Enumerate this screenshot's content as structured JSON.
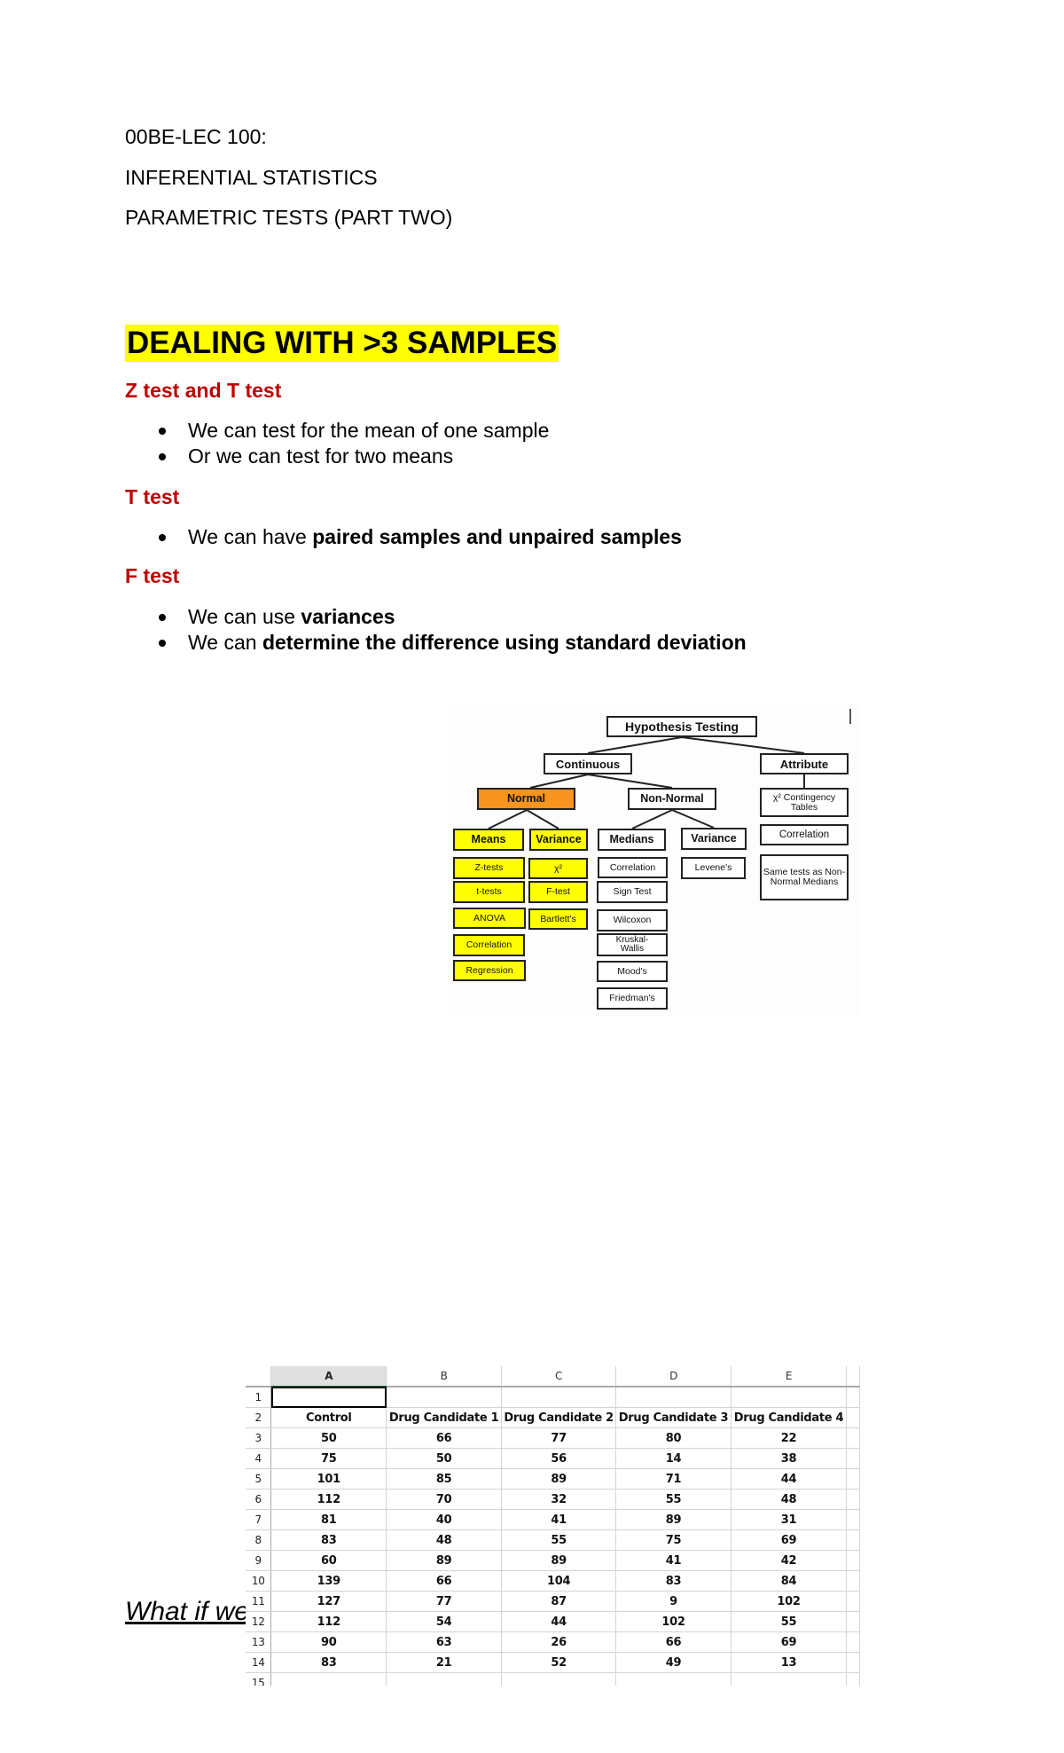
{
  "title_lines": [
    "00BE-LEC 100:",
    "INFERENTIAL STATISTICS",
    "PARAMETRIC TESTS (PART TWO)"
  ],
  "heading": "DEALING WITH >3 SAMPLES",
  "sections": [
    {
      "title": "Z test and T test",
      "bullets": [
        {
          "plain": "We can test for the mean of one sample",
          "bold": ""
        },
        {
          "plain": "Or we can test for two means",
          "bold": ""
        }
      ]
    },
    {
      "title": "T test",
      "bullets": [
        {
          "plain": "We can have ",
          "bold": "paired samples and unpaired samples"
        }
      ]
    },
    {
      "title": "F test",
      "bullets": [
        {
          "plain": "We can use ",
          "bold": "variances"
        },
        {
          "plain": "We can ",
          "bold": "determine the difference using standard deviation"
        }
      ]
    }
  ],
  "diagram": {
    "root": "Hypothesis Testing",
    "continuous": "Continuous",
    "attribute": "Attribute",
    "normal": "Normal",
    "non_normal": "Non-Normal",
    "means": "Means",
    "variance_normal": "Variance",
    "medians": "Medians",
    "variance_nonnormal": "Variance",
    "means_tests": [
      "Z-tests",
      "t-tests",
      "ANOVA",
      "Correlation",
      "Regression"
    ],
    "variance_tests": [
      "χ²",
      "F-test",
      "Bartlett's"
    ],
    "median_tests": [
      "Correlation",
      "Sign Test",
      "Wilcoxon",
      "Kruskal-Wallis",
      "Mood's",
      "Friedman's"
    ],
    "nn_variance_tests": [
      "Levene's"
    ],
    "attribute_tests": [
      "χ² Contingency Tables",
      "Correlation",
      "Same tests as Non-Normal Medians"
    ],
    "colors": {
      "normal": "#f7941d",
      "normal_children": "#ffff00"
    }
  },
  "spreadsheet": {
    "column_letters": [
      "A",
      "B",
      "C",
      "D",
      "E"
    ],
    "selected_cell": "A1",
    "headers": [
      "Control",
      "Drug Candidate 1",
      "Drug Candidate 2",
      "Drug Candidate 3",
      "Drug Candidate 4"
    ],
    "rows": [
      [
        50,
        66,
        77,
        80,
        22
      ],
      [
        75,
        50,
        56,
        14,
        38
      ],
      [
        101,
        85,
        89,
        71,
        44
      ],
      [
        112,
        70,
        32,
        55,
        48
      ],
      [
        81,
        40,
        41,
        89,
        31
      ],
      [
        83,
        48,
        55,
        75,
        69
      ],
      [
        60,
        89,
        89,
        41,
        42
      ],
      [
        139,
        66,
        104,
        83,
        84
      ],
      [
        127,
        77,
        87,
        9,
        102
      ],
      [
        112,
        54,
        44,
        102,
        55
      ],
      [
        90,
        63,
        26,
        66,
        69
      ],
      [
        83,
        21,
        52,
        49,
        13
      ]
    ]
  },
  "footer_text": "What if we"
}
